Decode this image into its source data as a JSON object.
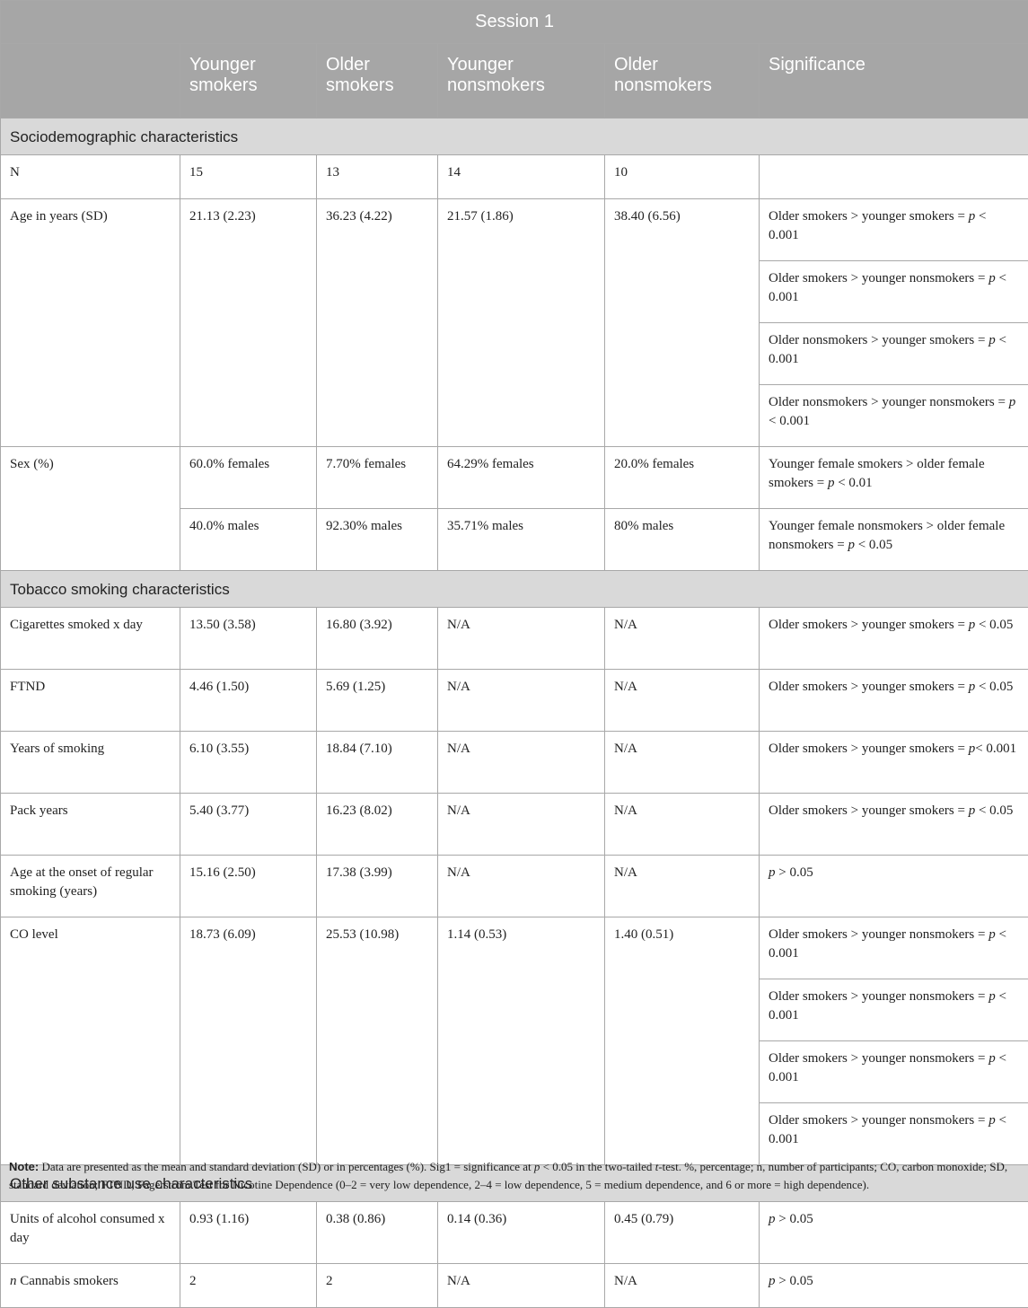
{
  "table": {
    "title": "Session 1",
    "columns": [
      "",
      "Younger smokers",
      "Older smokers",
      "Younger nonsmokers",
      "Older nonsmokers",
      "Significance"
    ],
    "sections": {
      "socio": "Sociodemographic characteristics",
      "tobacco": "Tobacco smoking characteristics",
      "other": "Other substance use characteristics"
    },
    "rows": {
      "n": {
        "label": "N",
        "values": [
          "15",
          "13",
          "14",
          "10"
        ]
      },
      "age": {
        "label": "Age in years (SD)",
        "values": [
          "21.13 (2.23)",
          "36.23 (4.22)",
          "21.57 (1.86)",
          "38.40 (6.56)"
        ],
        "sig": [
          {
            "pre": "Older smokers > younger smokers = ",
            "p": "p",
            "post": " < 0.001"
          },
          {
            "pre": "Older smokers > younger nonsmokers = ",
            "p": "p",
            "post": " < 0.001"
          },
          {
            "pre": "Older nonsmokers > younger smokers = ",
            "p": "p",
            "post": " < 0.001"
          },
          {
            "pre": "Older nonsmokers > younger nonsmokers = ",
            "p": "p",
            "post": " < 0.001"
          }
        ]
      },
      "sex": {
        "label": "Sex (%)",
        "female_values": [
          "60.0% females",
          "7.70% females",
          "64.29% females",
          "20.0% females"
        ],
        "male_values": [
          "40.0% males",
          "92.30% males",
          "35.71% males",
          "80% males"
        ],
        "sig": [
          {
            "pre": "Younger female smokers > older female smokers = ",
            "p": "p",
            "post": " < 0.01"
          },
          {
            "pre": "Younger female nonsmokers > older female nonsmokers = ",
            "p": "p",
            "post": " < 0.05"
          }
        ]
      },
      "cigs": {
        "label": "Cigarettes smoked x day",
        "values": [
          "13.50 (3.58)",
          "16.80 (3.92)",
          "N/A",
          "N/A"
        ],
        "sig": {
          "pre": "Older smokers > younger smokers = ",
          "p": "p",
          "post": " < 0.05"
        }
      },
      "ftnd": {
        "label": "FTND",
        "values": [
          "4.46 (1.50)",
          "5.69 (1.25)",
          "N/A",
          "N/A"
        ],
        "sig": {
          "pre": "Older smokers > younger smokers = ",
          "p": "p",
          "post": " < 0.05"
        }
      },
      "years": {
        "label": "Years of smoking",
        "values": [
          "6.10 (3.55)",
          "18.84 (7.10)",
          "N/A",
          "N/A"
        ],
        "sig": {
          "pre": "Older smokers > younger smokers = ",
          "p": "p",
          "post": "< 0.001"
        }
      },
      "pack": {
        "label": "Pack years",
        "values": [
          "5.40 (3.77)",
          "16.23 (8.02)",
          "N/A",
          "N/A"
        ],
        "sig": {
          "pre": "Older smokers > younger smokers = ",
          "p": "p",
          "post": " < 0.05"
        }
      },
      "onset": {
        "label": "Age at the onset of regular smoking (years)",
        "values": [
          "15.16 (2.50)",
          "17.38 (3.99)",
          "N/A",
          "N/A"
        ],
        "sig": {
          "pre": "",
          "p": "p",
          "post": " > 0.05"
        }
      },
      "co": {
        "label": "CO level",
        "values": [
          "18.73 (6.09)",
          "25.53 (10.98)",
          "1.14 (0.53)",
          "1.40 (0.51)"
        ],
        "sig": [
          {
            "pre": "Older smokers > younger nonsmokers = ",
            "p": "p",
            "post": " < 0.001"
          },
          {
            "pre": "Older smokers > younger nonsmokers = ",
            "p": "p",
            "post": " < 0.001"
          },
          {
            "pre": "Older smokers > younger nonsmokers = ",
            "p": "p",
            "post": " < 0.001"
          },
          {
            "pre": "Older smokers > younger nonsmokers = ",
            "p": "p",
            "post": " < 0.001"
          }
        ]
      },
      "alcohol": {
        "label": "Units of alcohol consumed x day",
        "values": [
          "0.93 (1.16)",
          "0.38 (0.86)",
          "0.14 (0.36)",
          "0.45 (0.79)"
        ],
        "sig": {
          "pre": "",
          "p": "p",
          "post": " > 0.05"
        }
      },
      "cannabis": {
        "label_italic": "n",
        "label": " Cannabis smokers",
        "values": [
          "2",
          "2",
          "N/A",
          "N/A"
        ],
        "sig": {
          "pre": "",
          "p": "p",
          "post": " > 0.05"
        }
      }
    }
  },
  "note": {
    "label": "Note:",
    "t1": " Data are presented as the mean and standard deviation (SD) or in percentages (%). Sig1 = significance at ",
    "p": "p",
    "t2": " < 0.05 in the two-tailed ",
    "t": "t",
    "t3": "-test. %, percentage; n, number of participants; CO, carbon monoxide; SD, standard deviation; FTND, Fagerström Test for Nicotine Dependence (0–2 = very low dependence, 2–4 = low dependence, 5 = medium dependence, and 6 or more = high dependence)."
  }
}
